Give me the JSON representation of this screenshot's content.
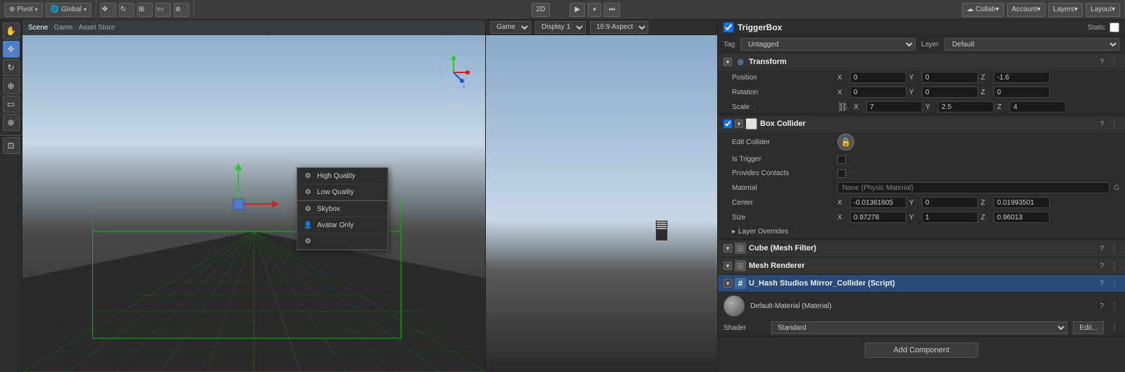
{
  "toolbar": {
    "pivot_label": "Pivot",
    "global_label": "Global",
    "mode_2d": "2D",
    "game_label": "Game",
    "display_label": "Display 1",
    "aspect_label": "16:9 Aspect"
  },
  "scene": {
    "tabs": [
      "Scene",
      "Game",
      "Asset Store"
    ],
    "active_tab": "Scene",
    "persp_label": "Persp",
    "context_menu": {
      "items": [
        {
          "icon": "⚙",
          "label": "High Quality"
        },
        {
          "icon": "⚙",
          "label": "Low Quality"
        },
        {
          "icon": "⚙",
          "label": "Skybox"
        },
        {
          "icon": "⚙",
          "label": "Avatar Only"
        },
        {
          "icon": "⚙",
          "label": ""
        }
      ]
    }
  },
  "game": {
    "header": "Game"
  },
  "inspector": {
    "object_name": "TriggerBox",
    "static_label": "Static",
    "tag_label": "Tag",
    "tag_value": "Untagged",
    "layer_label": "Layer",
    "layer_value": "Default",
    "transform": {
      "name": "Transform",
      "position_label": "Position",
      "position_x": "0",
      "position_y": "0",
      "position_z": "-1.6",
      "rotation_label": "Rotation",
      "rotation_x": "0",
      "rotation_y": "0",
      "rotation_z": "0",
      "scale_label": "Scale",
      "scale_x": "7",
      "scale_y": "2.5",
      "scale_z": "4"
    },
    "box_collider": {
      "name": "Box Collider",
      "edit_collider_label": "Edit Collider",
      "is_trigger_label": "Is Trigger",
      "provides_contacts_label": "Provides Contacts",
      "material_label": "Material",
      "material_value": "None (Physic Material)",
      "center_label": "Center",
      "center_x": "-0.01361605",
      "center_y": "0",
      "center_z": "0.01993501",
      "size_label": "Size",
      "size_x": "0.97278",
      "size_y": "1",
      "size_z": "0.96013",
      "layer_overrides_label": "Layer Overrides"
    },
    "cube_mesh_filter": {
      "name": "Cube (Mesh Filter)"
    },
    "mesh_renderer": {
      "name": "Mesh Renderer"
    },
    "script": {
      "name": "U_Hash Studios Mirror_Collider (Script)"
    },
    "material_section": {
      "material_name": "Default-Material (Material)",
      "shader_label": "Shader",
      "shader_value": "Standard",
      "edit_btn": "Edit..."
    },
    "add_component_btn": "Add Component"
  },
  "icons": {
    "pivot": "⊕",
    "global": "🌐",
    "transform_tools": "✥",
    "snap": "⊞",
    "play": "▶",
    "pause": "⏸",
    "step": "⏭",
    "collab": "☁",
    "account": "👤",
    "layers": "☰",
    "layout": "⊡",
    "chevron": "▾",
    "expand": "▸",
    "collapse": "▾",
    "settings": "✱",
    "question": "?",
    "kebab": "⋮",
    "lock": "🔒",
    "transform_icon": "⊕",
    "collider_icon": "⬜",
    "mesh_icon": "⬛",
    "script_icon": "#",
    "sphere_icon": "◉"
  }
}
